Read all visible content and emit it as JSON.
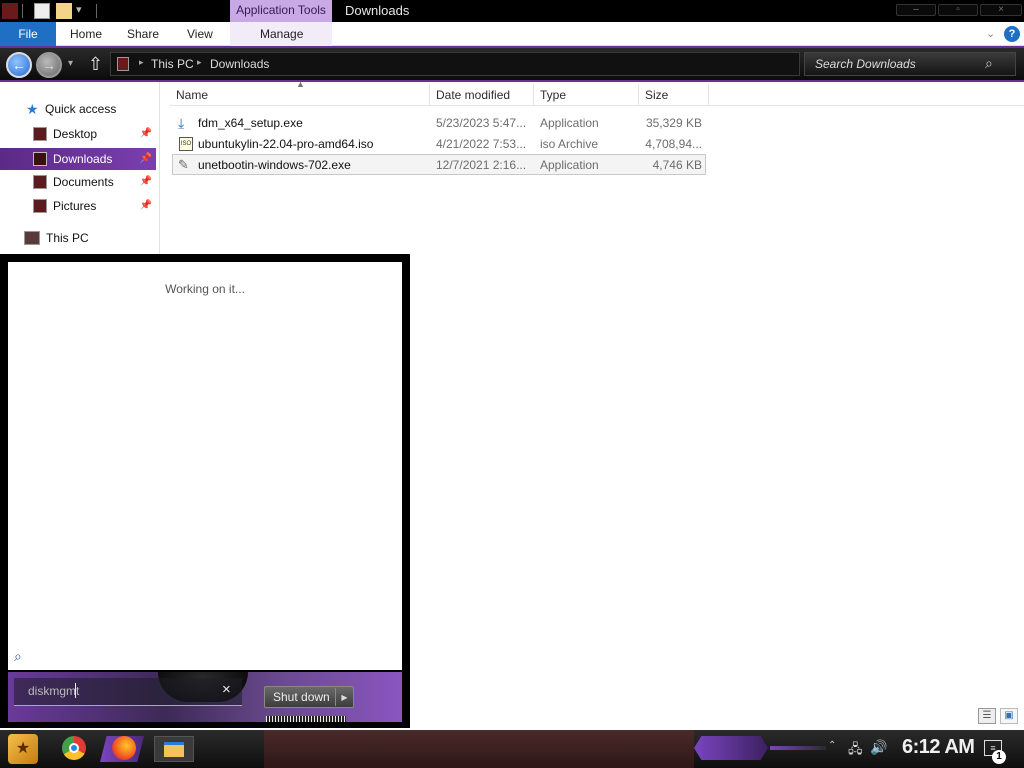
{
  "titlebar": {
    "context_tab": "Application Tools",
    "window_title": "Downloads",
    "controls": [
      "minimize-icon",
      "maximize-icon",
      "close-icon"
    ]
  },
  "ribbon": {
    "tabs": [
      "File",
      "Home",
      "Share",
      "View",
      "Manage"
    ]
  },
  "address": {
    "crumbs": [
      "This PC",
      "Downloads"
    ],
    "search_placeholder": "Search Downloads"
  },
  "nav": {
    "quick_access": "Quick access",
    "items": [
      {
        "label": "Desktop",
        "pinned": true
      },
      {
        "label": "Downloads",
        "pinned": true,
        "selected": true
      },
      {
        "label": "Documents",
        "pinned": true
      },
      {
        "label": "Pictures",
        "pinned": true
      }
    ],
    "this_pc": "This PC"
  },
  "columns": [
    "Name",
    "Date modified",
    "Type",
    "Size"
  ],
  "files": [
    {
      "name": "fdm_x64_setup.exe",
      "date": "5/23/2023 5:47...",
      "type": "Application",
      "size": "35,329 KB"
    },
    {
      "name": "ubuntukylin-22.04-pro-amd64.iso",
      "date": "4/21/2022 7:53...",
      "type": "iso Archive",
      "size": "4,708,94..."
    },
    {
      "name": "unetbootin-windows-702.exe",
      "date": "12/7/2021 2:16...",
      "type": "Application",
      "size": "4,746 KB"
    }
  ],
  "start_menu": {
    "status": "Working on it...",
    "search_value": "diskmgmt",
    "shutdown_label": "Shut down"
  },
  "taskbar": {
    "clock": "6:12 AM",
    "notification_count": "1",
    "apps": [
      "start-icon",
      "chrome-icon",
      "firefox-icon",
      "file-explorer-icon"
    ]
  },
  "colors": {
    "accent": "#6a2f93",
    "file_tab": "#1f6fc4",
    "selected_nav": "#5b2a86"
  }
}
